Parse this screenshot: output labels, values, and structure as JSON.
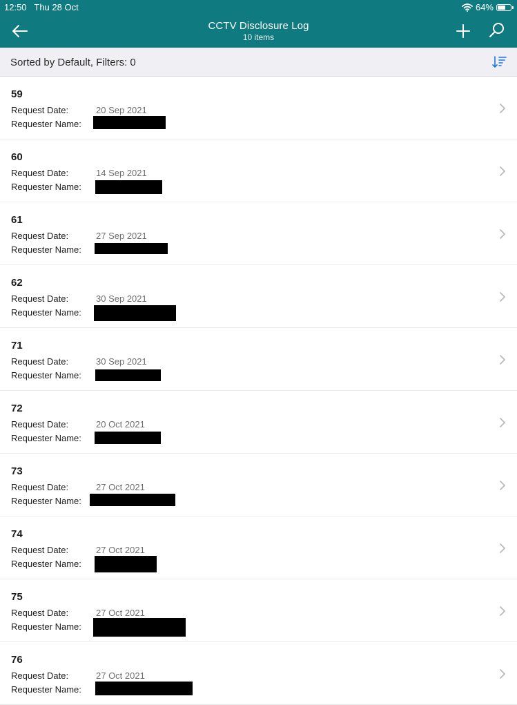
{
  "status_bar": {
    "time": "12:50",
    "date": "Thu 28 Oct",
    "battery": "64%",
    "battery_level": 0.64
  },
  "header": {
    "title": "CCTV Disclosure Log",
    "subtitle": "10 items"
  },
  "sort_bar": {
    "text": "Sorted by Default, Filters: 0"
  },
  "labels": {
    "request_date": "Request Date:",
    "requester_name": "Requester Name:"
  },
  "rows": [
    {
      "id": "59",
      "request_date": "20 Sep 2021"
    },
    {
      "id": "60",
      "request_date": "14 Sep 2021"
    },
    {
      "id": "61",
      "request_date": "27 Sep 2021"
    },
    {
      "id": "62",
      "request_date": "30 Sep 2021"
    },
    {
      "id": "71",
      "request_date": "30 Sep 2021"
    },
    {
      "id": "72",
      "request_date": "20 Oct 2021"
    },
    {
      "id": "73",
      "request_date": "27 Oct 2021"
    },
    {
      "id": "74",
      "request_date": "27 Oct 2021"
    },
    {
      "id": "75",
      "request_date": "27 Oct 2021"
    },
    {
      "id": "76",
      "request_date": "27 Oct 2021"
    }
  ],
  "colors": {
    "header_bg": "#0f7a7f",
    "sort_bar_bg": "#efeff4",
    "accent": "#1a73e8"
  },
  "icons": [
    "back-arrow-icon",
    "add-icon",
    "search-icon",
    "sort-icon",
    "chevron-right-icon",
    "wifi-icon",
    "battery-icon"
  ]
}
